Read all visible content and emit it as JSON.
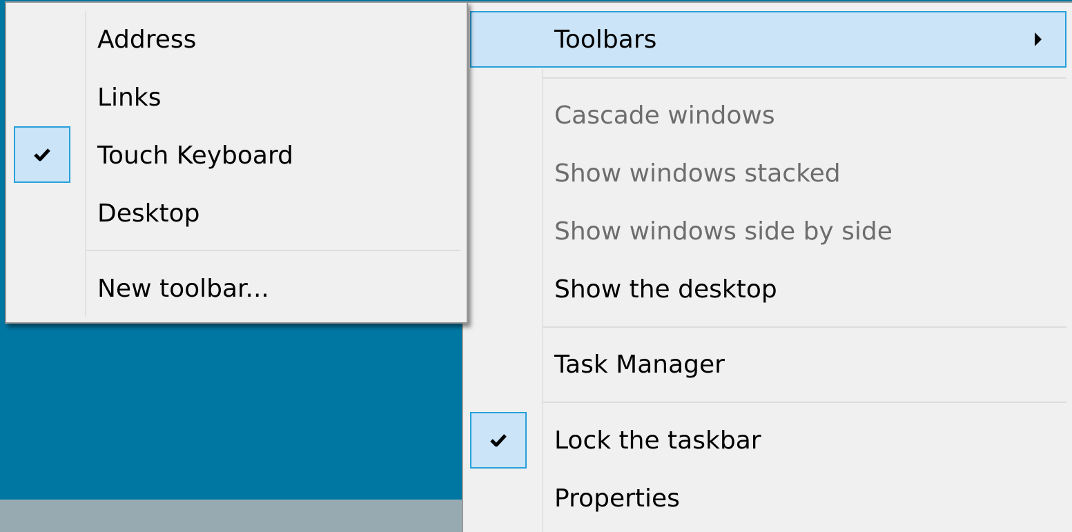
{
  "toolbars_submenu": {
    "items": [
      {
        "label": "Address",
        "checked": false
      },
      {
        "label": "Links",
        "checked": false
      },
      {
        "label": "Touch Keyboard",
        "checked": true
      },
      {
        "label": "Desktop",
        "checked": false
      }
    ],
    "new_toolbar_label": "New toolbar..."
  },
  "taskbar_menu": {
    "toolbars_label": "Toolbars",
    "cascade_label": "Cascade windows",
    "stacked_label": "Show windows stacked",
    "side_by_side_label": "Show windows side by side",
    "show_desktop_label": "Show the desktop",
    "task_manager_label": "Task Manager",
    "lock_taskbar_label": "Lock the taskbar",
    "lock_taskbar_checked": true,
    "properties_label": "Properties"
  },
  "colors": {
    "desktop_background": "#0077a3",
    "menu_background": "#f0f0f0",
    "highlight_fill": "#cce4f7",
    "highlight_border": "#26a0da",
    "disabled_text": "#6d6d6d"
  },
  "icons": {
    "check": "check-icon",
    "submenu_arrow": "chevron-right-icon"
  }
}
